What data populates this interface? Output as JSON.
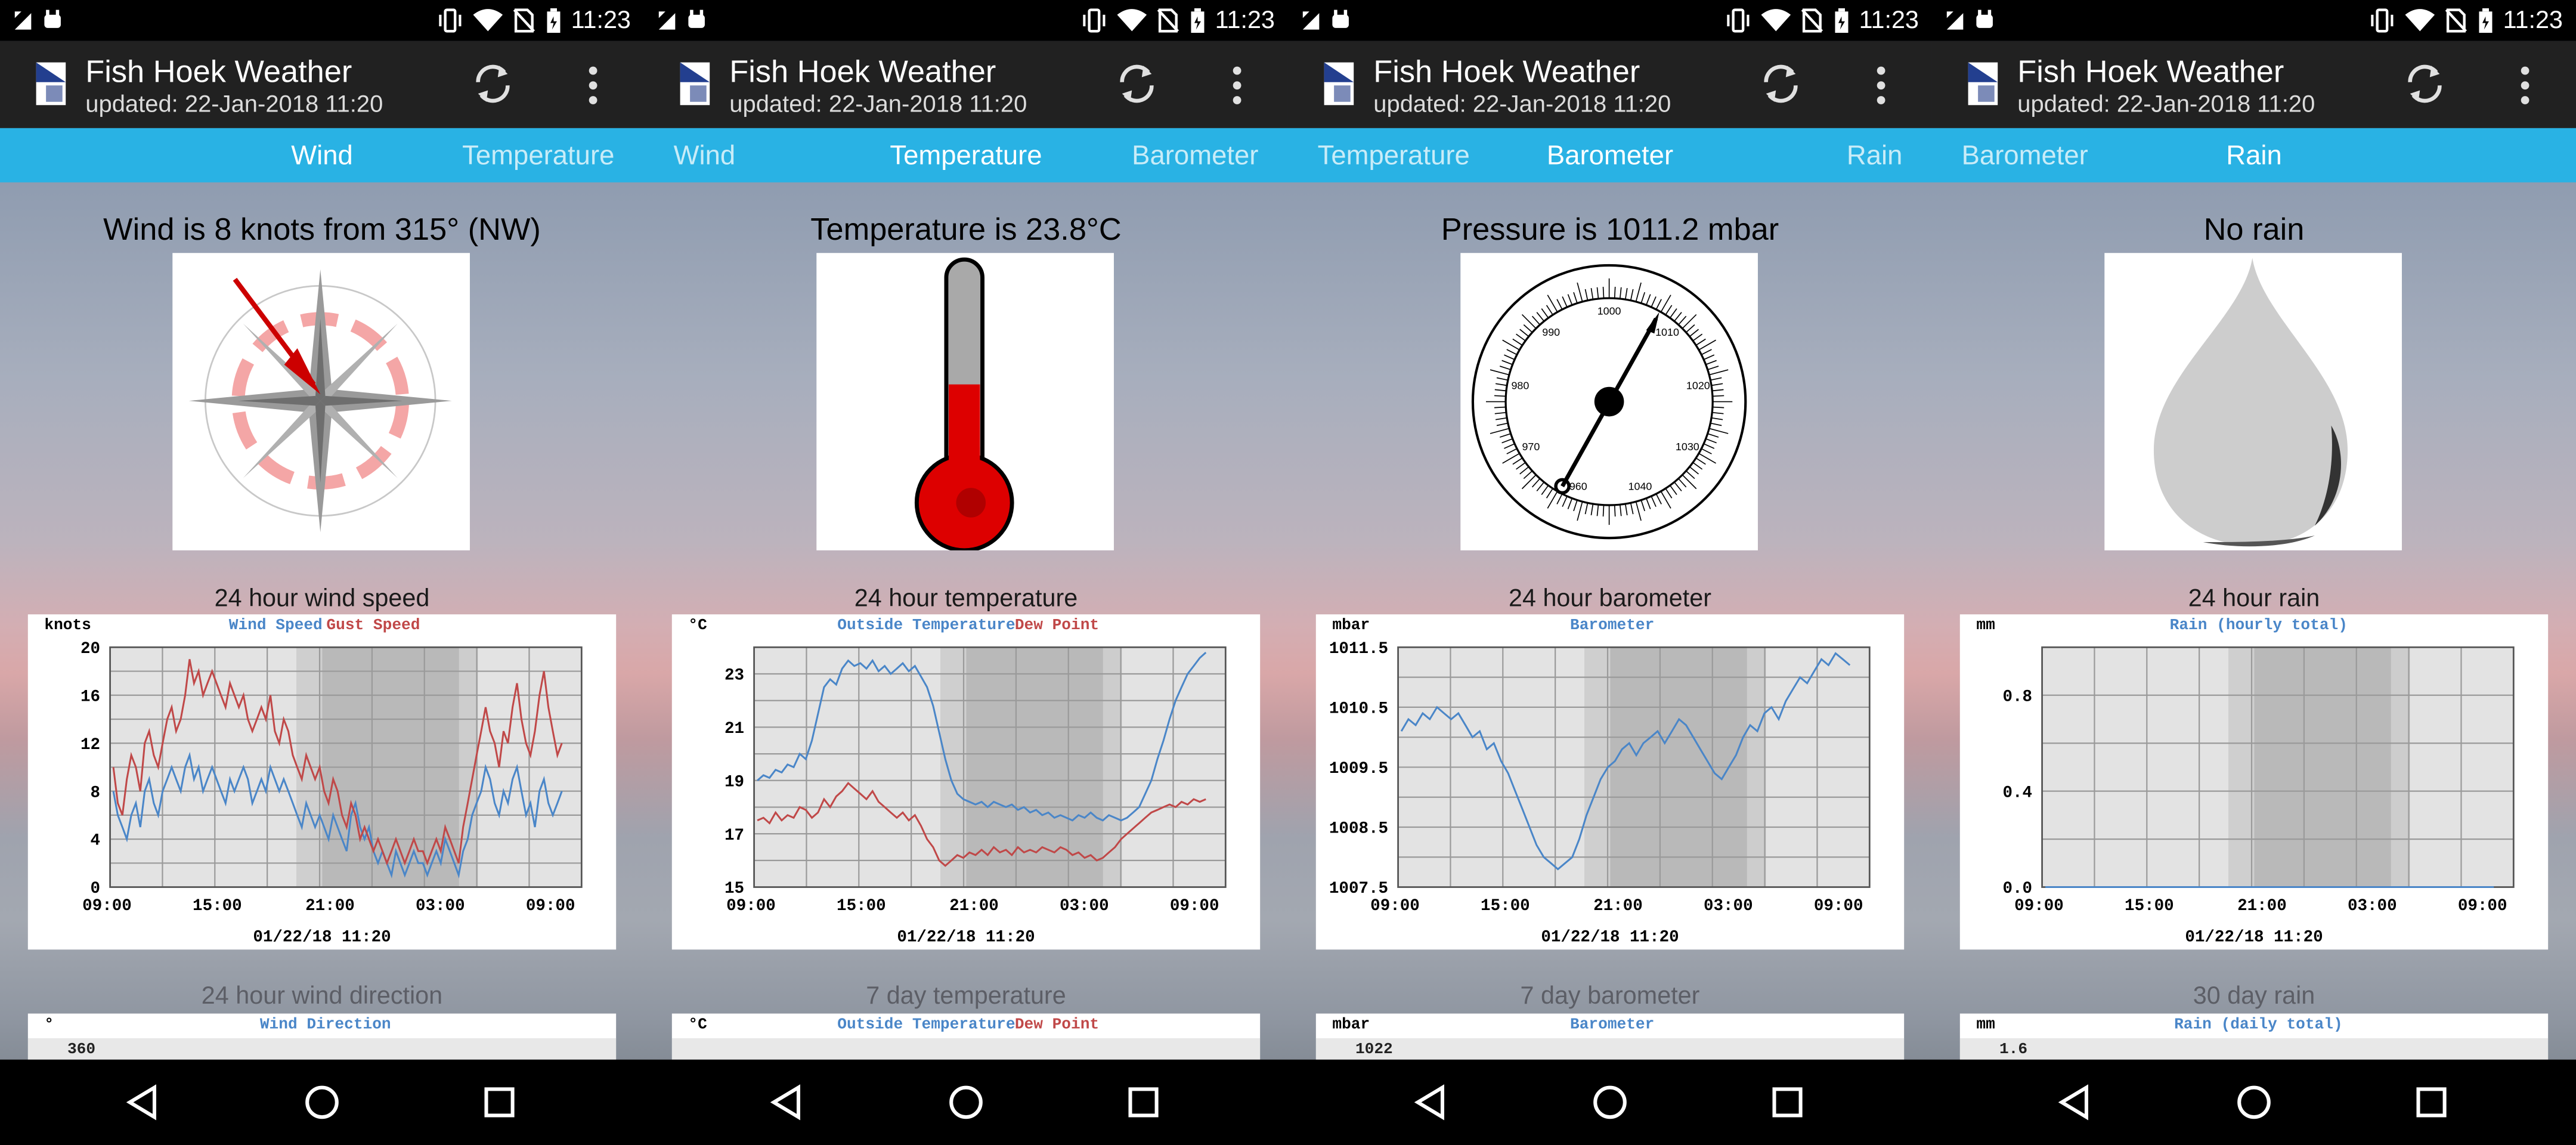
{
  "status": {
    "time": "11:23"
  },
  "app": {
    "title": "Fish Hoek Weather",
    "updated": "updated: 22-Jan-2018 11:20"
  },
  "colors": {
    "tab_bar": "#29b2e4",
    "toolbar": "#212121",
    "wind_series": "#4a86c8",
    "gust_series": "#c04848",
    "thermometer": "#dd0000"
  },
  "timestamp": "01/22/18 11:20",
  "panels": [
    {
      "tabs": {
        "left": "",
        "center": "Wind",
        "right": "Temperature"
      },
      "headline": "Wind is 8 knots from 315° (NW)",
      "icon": "compass-rose-icon",
      "chart_caption": "24 hour wind speed",
      "second_caption": "24 hour wind direction",
      "second_chart": {
        "unit": "°",
        "legend": [
          "Wind Direction"
        ],
        "first_tick": "360"
      }
    },
    {
      "tabs": {
        "left": "Wind",
        "center": "Temperature",
        "right": "Barometer"
      },
      "headline": "Temperature is 23.8°C",
      "icon": "thermometer-icon",
      "chart_caption": "24 hour temperature",
      "second_caption": "7 day temperature",
      "second_chart": {
        "unit": "°C",
        "legend": [
          "Outside Temperature",
          "Dew Point"
        ],
        "first_tick": ""
      }
    },
    {
      "tabs": {
        "left": "Temperature",
        "center": "Barometer",
        "right": "Rain"
      },
      "headline": "Pressure is 1011.2 mbar",
      "icon": "barometer-gauge-icon",
      "gauge_labels": [
        "1000",
        "1010",
        "1020",
        "1030",
        "1040",
        "990",
        "980",
        "970",
        "960"
      ],
      "chart_caption": "24 hour barometer",
      "second_caption": "7 day barometer",
      "second_chart": {
        "unit": "mbar",
        "legend": [
          "Barometer"
        ],
        "first_tick": "1022"
      }
    },
    {
      "tabs": {
        "left": "Barometer",
        "center": "Rain",
        "right": ""
      },
      "headline": "No rain",
      "icon": "raindrop-icon",
      "chart_caption": "24 hour rain",
      "second_caption": "30 day rain",
      "second_chart": {
        "unit": "mm",
        "legend": [
          "Rain (daily total)"
        ],
        "first_tick": "1.6"
      }
    }
  ],
  "chart_data": [
    {
      "type": "line",
      "unit": "knots",
      "x_ticks": [
        "09:00",
        "15:00",
        "21:00",
        "03:00",
        "09:00"
      ],
      "ylim": [
        0,
        20
      ],
      "y_ticks": [
        "0",
        "4",
        "8",
        "12",
        "16",
        "20"
      ],
      "xlabel": "01/22/18 11:20",
      "series": [
        {
          "name": "Wind Speed",
          "color": "#4a86c8",
          "values": [
            8,
            6,
            5,
            4,
            6,
            7,
            5,
            8,
            9,
            7,
            6,
            8,
            9,
            10,
            9,
            8,
            10,
            11,
            9,
            10,
            8,
            9,
            10,
            9,
            8,
            7,
            9,
            8,
            9,
            10,
            9,
            7,
            8,
            9,
            8,
            10,
            9,
            8,
            9,
            8,
            7,
            6,
            5,
            7,
            6,
            5,
            6,
            5,
            4,
            6,
            5,
            4,
            3,
            6,
            7,
            5,
            4,
            5,
            3,
            2,
            3,
            2,
            1,
            3,
            2,
            1,
            2,
            3,
            2,
            2,
            1,
            2,
            3,
            2,
            4,
            3,
            2,
            1,
            3,
            4,
            6,
            7,
            8,
            10,
            9,
            7,
            6,
            8,
            7,
            9,
            10,
            8,
            6,
            7,
            5,
            8,
            9,
            7,
            6,
            7,
            8
          ]
        },
        {
          "name": "Gust Speed",
          "color": "#c04848",
          "values": [
            10,
            7,
            6,
            9,
            11,
            10,
            8,
            12,
            13,
            11,
            10,
            12,
            14,
            15,
            13,
            14,
            16,
            19,
            17,
            18,
            16,
            17,
            18,
            17,
            16,
            15,
            17,
            16,
            15,
            16,
            14,
            13,
            14,
            15,
            14,
            16,
            13,
            12,
            14,
            13,
            11,
            10,
            9,
            11,
            10,
            9,
            10,
            8,
            7,
            9,
            8,
            6,
            5,
            7,
            6,
            4,
            5,
            4,
            3,
            4,
            3,
            2,
            3,
            4,
            3,
            2,
            3,
            4,
            3,
            3,
            2,
            3,
            4,
            3,
            5,
            4,
            3,
            2,
            5,
            7,
            9,
            11,
            13,
            15,
            13,
            12,
            10,
            13,
            12,
            15,
            17,
            14,
            12,
            11,
            13,
            16,
            18,
            15,
            13,
            11,
            12
          ]
        }
      ]
    },
    {
      "type": "line",
      "unit": "°C",
      "x_ticks": [
        "09:00",
        "15:00",
        "21:00",
        "03:00",
        "09:00"
      ],
      "ylim": [
        15,
        24
      ],
      "y_ticks": [
        "15",
        "17",
        "19",
        "21",
        "23"
      ],
      "xlabel": "01/22/18 11:20",
      "series": [
        {
          "name": "Outside Temperature",
          "color": "#4a86c8",
          "values": [
            19.0,
            19.2,
            19.1,
            19.4,
            19.3,
            19.6,
            19.5,
            20.0,
            19.8,
            20.5,
            21.5,
            22.5,
            22.8,
            22.6,
            23.2,
            23.5,
            23.3,
            23.4,
            23.2,
            23.5,
            23.1,
            23.3,
            23.0,
            23.2,
            23.4,
            23.1,
            23.3,
            22.9,
            22.5,
            21.8,
            20.8,
            19.8,
            19.0,
            18.5,
            18.3,
            18.2,
            18.1,
            18.2,
            18.0,
            18.2,
            18.1,
            18.0,
            18.1,
            17.9,
            18.0,
            17.8,
            17.9,
            17.7,
            17.8,
            17.6,
            17.7,
            17.6,
            17.5,
            17.7,
            17.6,
            17.8,
            17.6,
            17.5,
            17.7,
            17.6,
            17.5,
            17.6,
            17.8,
            18.0,
            18.5,
            19.0,
            19.8,
            20.5,
            21.3,
            22.0,
            22.5,
            23.0,
            23.3,
            23.6,
            23.8
          ]
        },
        {
          "name": "Dew Point",
          "color": "#c04848",
          "values": [
            17.5,
            17.6,
            17.4,
            17.8,
            17.5,
            17.7,
            17.6,
            18.0,
            17.9,
            17.6,
            17.8,
            18.3,
            18.0,
            18.4,
            18.6,
            18.9,
            18.7,
            18.5,
            18.3,
            18.6,
            18.2,
            18.0,
            17.8,
            17.6,
            17.8,
            17.5,
            17.7,
            17.3,
            16.8,
            16.5,
            16.0,
            15.8,
            16.0,
            16.2,
            16.1,
            16.3,
            16.2,
            16.4,
            16.2,
            16.5,
            16.3,
            16.4,
            16.2,
            16.5,
            16.3,
            16.4,
            16.3,
            16.5,
            16.4,
            16.3,
            16.5,
            16.4,
            16.2,
            16.3,
            16.1,
            16.2,
            16.0,
            16.1,
            16.3,
            16.5,
            16.8,
            17.0,
            17.2,
            17.4,
            17.6,
            17.8,
            17.9,
            18.0,
            18.1,
            18.0,
            18.2,
            18.1,
            18.3,
            18.2,
            18.3
          ]
        }
      ]
    },
    {
      "type": "line",
      "unit": "mbar",
      "x_ticks": [
        "09:00",
        "15:00",
        "21:00",
        "03:00",
        "09:00"
      ],
      "ylim": [
        1007.5,
        1011.5
      ],
      "y_ticks": [
        "1007.5",
        "1008.5",
        "1009.5",
        "1010.5",
        "1011.5"
      ],
      "xlabel": "01/22/18 11:20",
      "series": [
        {
          "name": "Barometer",
          "color": "#4a86c8",
          "values": [
            1010.1,
            1010.3,
            1010.2,
            1010.4,
            1010.3,
            1010.5,
            1010.4,
            1010.3,
            1010.4,
            1010.2,
            1010.0,
            1010.1,
            1009.8,
            1009.9,
            1009.6,
            1009.4,
            1009.1,
            1008.8,
            1008.5,
            1008.2,
            1008.0,
            1007.9,
            1007.8,
            1007.9,
            1008.0,
            1008.3,
            1008.7,
            1009.0,
            1009.3,
            1009.5,
            1009.6,
            1009.8,
            1009.9,
            1009.7,
            1009.9,
            1010.0,
            1010.1,
            1009.9,
            1010.1,
            1010.3,
            1010.2,
            1010.0,
            1009.8,
            1009.6,
            1009.4,
            1009.3,
            1009.5,
            1009.7,
            1010.0,
            1010.2,
            1010.1,
            1010.4,
            1010.5,
            1010.3,
            1010.6,
            1010.8,
            1011.0,
            1010.9,
            1011.1,
            1011.3,
            1011.2,
            1011.4,
            1011.3,
            1011.2
          ]
        }
      ]
    },
    {
      "type": "line",
      "unit": "mm",
      "x_ticks": [
        "09:00",
        "15:00",
        "21:00",
        "03:00",
        "09:00"
      ],
      "ylim": [
        0,
        1
      ],
      "y_ticks": [
        "0.0",
        "0.4",
        "0.8"
      ],
      "xlabel": "01/22/18 11:20",
      "series": [
        {
          "name": "Rain (hourly total)",
          "color": "#4a86c8",
          "values": [
            0,
            0,
            0,
            0,
            0,
            0,
            0,
            0,
            0,
            0,
            0,
            0,
            0,
            0,
            0,
            0,
            0,
            0,
            0,
            0,
            0,
            0,
            0,
            0,
            0
          ]
        }
      ]
    }
  ]
}
